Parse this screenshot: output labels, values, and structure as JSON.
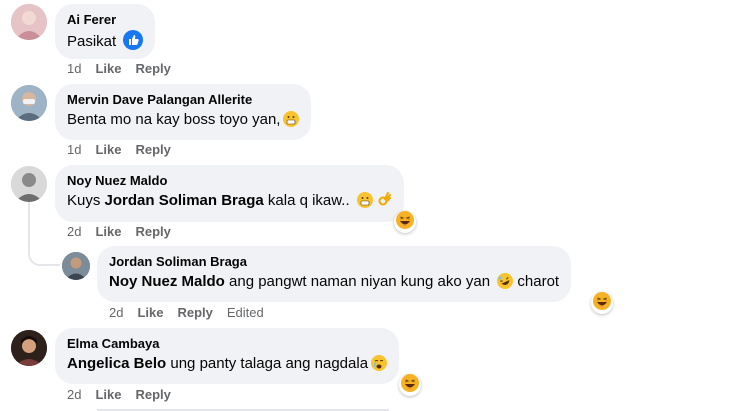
{
  "comments": [
    {
      "author": "Ai Ferer",
      "text": "Pasikat",
      "time": "1d",
      "like": "Like",
      "reply": "Reply"
    },
    {
      "author": "Mervin Dave Palangan Allerite",
      "text": "Benta mo na kay boss toyo yan,",
      "time": "1d",
      "like": "Like",
      "reply": "Reply"
    },
    {
      "author": "Noy Nuez Maldo",
      "text_prefix": "Kuys ",
      "mention": "Jordan Soliman Braga",
      "text_suffix": " kala q ikaw..",
      "time": "2d",
      "like": "Like",
      "reply": "Reply"
    },
    {
      "author": "Jordan Soliman Braga",
      "mention": "Noy Nuez Maldo",
      "text_suffix": " ang pangwt naman niyan kung ako yan",
      "text_tail": " charot",
      "time": "2d",
      "like": "Like",
      "reply": "Reply",
      "edited": "Edited"
    },
    {
      "author": "Elma Cambaya",
      "mention": "Angelica Belo",
      "text_suffix": " ung panty talaga ang nagdala",
      "time": "2d",
      "like": "Like",
      "reply": "Reply"
    }
  ],
  "icons": {
    "like_reaction": "thumbs-up-icon",
    "haha_reaction": "laughing-face-icon",
    "emoji_grimace": "grimace-emoji-icon",
    "emoji_ok_hand": "ok-hand-emoji-icon",
    "emoji_rofl": "rolling-laughing-emoji-icon",
    "emoji_crying": "crying-emoji-icon"
  },
  "colors": {
    "bubble": "#f0f2f5",
    "meta": "#65676b",
    "like_blue": "#1877f2",
    "haha_yellow": "#f7b125"
  }
}
